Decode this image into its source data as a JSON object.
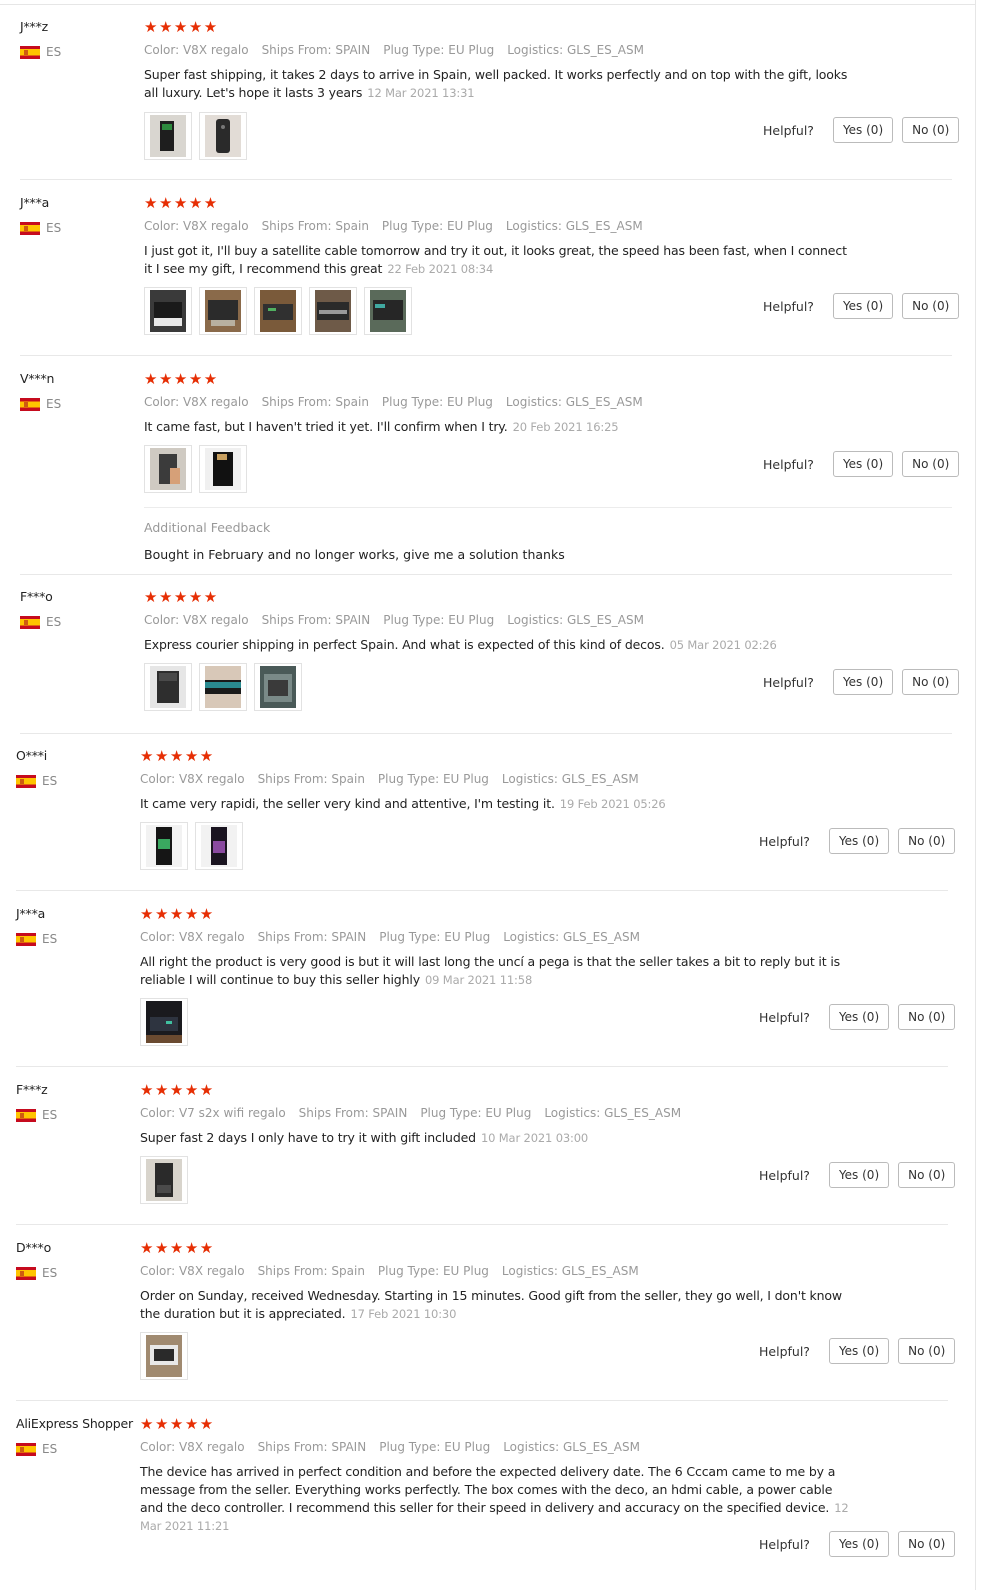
{
  "reviews": [
    {
      "user": "J***z",
      "country": "ES",
      "stars": 5,
      "color": "Color: V8X regalo",
      "ships": "Ships From: SPAIN",
      "plug": "Plug Type: EU Plug",
      "logistics": "Logistics: GLS_ES_ASM",
      "text": "Super fast shipping, it takes 2 days to arrive in Spain, well packed. It works perfectly and on top with the gift, looks all luxury. Let's hope it lasts 3 years",
      "date": "12 Mar 2021 13:31",
      "photos": [
        "phone-in-box",
        "tv-box-remote"
      ],
      "helpful": "Helpful?",
      "yes": "Yes (0)",
      "no": "No (0)"
    },
    {
      "user": "J***a",
      "country": "ES",
      "stars": 5,
      "color": "Color: V8X regalo",
      "ships": "Ships From: Spain",
      "plug": "Plug Type: EU Plug",
      "logistics": "Logistics: GLS_ES_ASM",
      "text": "I just got it, I'll buy a satellite cable tomorrow and try it out, it looks great, the speed has been fast, when I connect it I see my gift, I recommend this great",
      "date": "22 Feb 2021 08:34",
      "photos": [
        "receiver-box",
        "receiver-device",
        "receiver-front",
        "receiver-open",
        "receiver-side"
      ],
      "helpful": "Helpful?",
      "yes": "Yes (0)",
      "no": "No (0)"
    },
    {
      "user": "V***n",
      "country": "ES",
      "stars": 5,
      "color": "Color: V8X regalo",
      "ships": "Ships From: Spain",
      "plug": "Plug Type: EU Plug",
      "logistics": "Logistics: GLS_ES_ASM",
      "text": "It came fast, but I haven't tried it yet. I'll confirm when I try.",
      "date": "20 Feb 2021 16:25",
      "photos": [
        "box-in-hand",
        "black-device"
      ],
      "helpful": "Helpful?",
      "yes": "Yes (0)",
      "no": "No (0)",
      "additional_label": "Additional Feedback",
      "additional_text": "Bought in February and no longer works, give me a solution thanks"
    },
    {
      "user": "F***o",
      "country": "ES",
      "stars": 5,
      "color": "Color: V8X regalo",
      "ships": "Ships From: SPAIN",
      "plug": "Plug Type: EU Plug",
      "logistics": "Logistics: GLS_ES_ASM",
      "text": "Express courier shipping in perfect Spain. And what is expected of this kind of decos.",
      "date": "05 Mar 2021 02:26",
      "photos": [
        "product-box",
        "teal-package",
        "wrapped-parcel"
      ],
      "helpful": "Helpful?",
      "yes": "Yes (0)",
      "no": "No (0)"
    },
    {
      "user": "O***i",
      "country": "ES",
      "stars": 5,
      "color": "Color: V8X regalo",
      "ships": "Ships From: Spain",
      "plug": "Plug Type: EU Plug",
      "logistics": "Logistics: GLS_ES_ASM",
      "text": "It came very rapidi, the seller very kind and attentive, I'm testing it.",
      "date": "19 Feb 2021 05:26",
      "photos": [
        "tv-screen-green",
        "tv-screen-purple"
      ],
      "helpful": "Helpful?",
      "yes": "Yes (0)",
      "no": "No (0)"
    },
    {
      "user": "J***a",
      "country": "ES",
      "stars": 5,
      "color": "Color: V8X regalo",
      "ships": "Ships From: SPAIN",
      "plug": "Plug Type: EU Plug",
      "logistics": "Logistics: GLS_ES_ASM",
      "text": "All right the product is very good is but it will last long the uncí a pega is that the seller takes a bit to reply but it is reliable I will continue to buy this seller highly",
      "date": "09 Mar 2021 11:58",
      "photos": [
        "device-on-table"
      ],
      "helpful": "Helpful?",
      "yes": "Yes (0)",
      "no": "No (0)"
    },
    {
      "user": "F***z",
      "country": "ES",
      "stars": 5,
      "color": "Color: V7 s2x wifi regalo",
      "ships": "Ships From: SPAIN",
      "plug": "Plug Type: EU Plug",
      "logistics": "Logistics: GLS_ES_ASM",
      "text": "Super fast 2 days I only have to try it with gift included",
      "date": "10 Mar 2021 03:00",
      "photos": [
        "box-held"
      ],
      "helpful": "Helpful?",
      "yes": "Yes (0)",
      "no": "No (0)"
    },
    {
      "user": "D***o",
      "country": "ES",
      "stars": 5,
      "color": "Color: V8X regalo",
      "ships": "Ships From: Spain",
      "plug": "Plug Type: EU Plug",
      "logistics": "Logistics: GLS_ES_ASM",
      "text": "Order on Sunday, received Wednesday. Starting in 15 minutes. Good gift from the seller, they go well, I don't know the duration but it is appreciated.",
      "date": "17 Feb 2021 10:30",
      "photos": [
        "box-on-table"
      ],
      "helpful": "Helpful?",
      "yes": "Yes (0)",
      "no": "No (0)"
    },
    {
      "user": "AliExpress Shopper",
      "country": "ES",
      "stars": 5,
      "color": "Color: V8X regalo",
      "ships": "Ships From: SPAIN",
      "plug": "Plug Type: EU Plug",
      "logistics": "Logistics: GLS_ES_ASM",
      "text": "The device has arrived in perfect condition and before the expected delivery date. The 6 Cccam came to me by a message from the seller. Everything works perfectly. The box comes with the deco, an hdmi cable, a power cable and the deco controller. I recommend this seller for their speed in delivery and accuracy on the specified device.",
      "date": "12 Mar 2021 11:21",
      "photos": [],
      "helpful": "Helpful?",
      "yes": "Yes (0)",
      "no": "No (0)"
    }
  ],
  "star_glyph": "★★★★★",
  "colors": {
    "star": "#e62e04",
    "meta": "#999999",
    "border": "#e8e8e8"
  }
}
